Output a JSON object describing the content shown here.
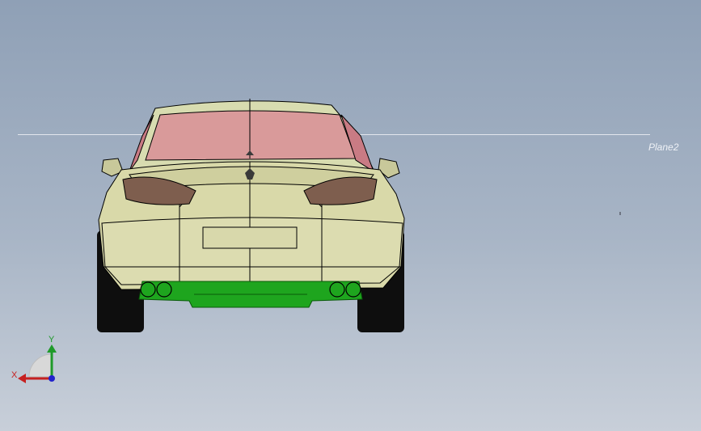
{
  "window": {
    "title": ""
  },
  "viewport": {
    "plane_label": "Plane2",
    "triad": {
      "x_label": "X",
      "y_label": "Y"
    },
    "colors": {
      "background_top": "#8fa0b6",
      "background_bottom": "#c8cfd9",
      "body": "#d9d9a8",
      "glass": "#d99a9a",
      "taillight": "#8a6a58",
      "bumper": "#1ea51e",
      "tire": "#111111"
    },
    "icons": [
      "car-model",
      "coordinate-triad"
    ]
  }
}
